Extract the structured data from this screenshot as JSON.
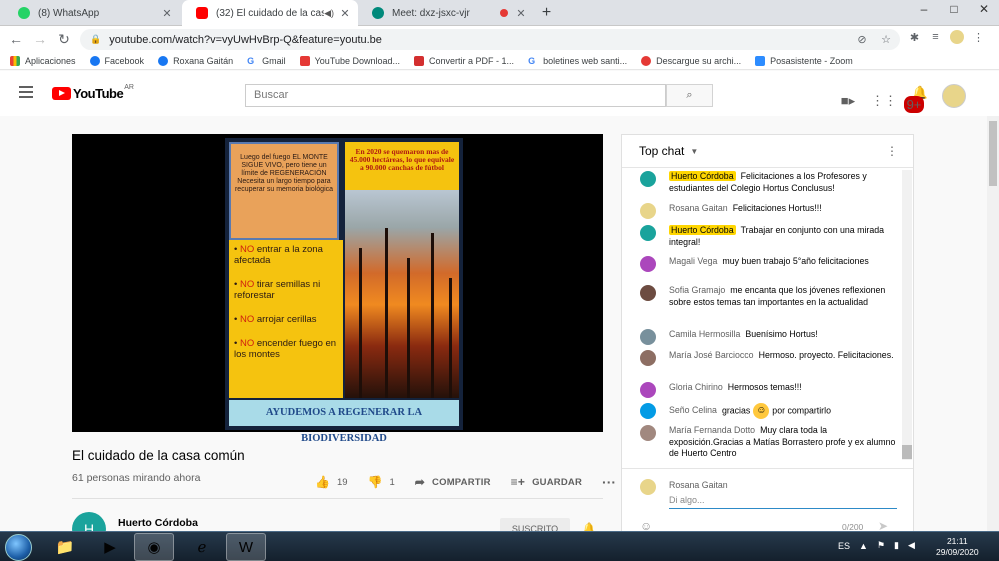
{
  "browser": {
    "tabs": [
      {
        "title": "(8) WhatsApp",
        "fav_color": "#25d366"
      },
      {
        "title": "(32) El cuidado de la casa com",
        "fav_color": "#ff0000"
      },
      {
        "title": "Meet: dxz-jsxc-vjr",
        "fav_color": "#00897b"
      }
    ],
    "new_tab": "+",
    "url": "youtube.com/watch?v=vyUwHvBrp-Q&feature=youtu.be",
    "bookmarks": [
      {
        "label": "Aplicaciones",
        "color": "#e94235"
      },
      {
        "label": "Facebook",
        "color": "#1877f2"
      },
      {
        "label": "Roxana Gaitán",
        "color": "#1877f2"
      },
      {
        "label": "Gmail",
        "color": "#ea4335"
      },
      {
        "label": "YouTube Download...",
        "color": "#e53935"
      },
      {
        "label": "Convertir a PDF - 1...",
        "color": "#d32f2f"
      },
      {
        "label": "boletines web santi...",
        "color": "#4285f4"
      },
      {
        "label": "Descargue su archi...",
        "color": "#e53935"
      },
      {
        "label": "Posasistente - Zoom",
        "color": "#2d8cff"
      }
    ]
  },
  "youtube": {
    "logo": "YouTube",
    "country": "AR",
    "search_placeholder": "Buscar",
    "notif_count": "9+"
  },
  "poster": {
    "left_top": "Luego del fuego EL MONTE SIGUE VIVO, pero tiene un límite de REGENERACIÓN Necesita un largo tiempo para recuperar su memoria biológica",
    "right_top": "En 2020 se quemaron mas de 45.000 hectáreas, lo que equivale a 90.000 canchas de fútbol",
    "rules": [
      {
        "no": "NO",
        "text": " entrar a la zona afectada"
      },
      {
        "no": "NO",
        "text": " tirar semillas ni reforestar"
      },
      {
        "no": "NO",
        "text": " arrojar cerillas"
      },
      {
        "no": "NO",
        "text": " encender fuego en los montes"
      }
    ],
    "banner": "AYUDEMOS A REGENERAR LA BIODIVERSIDAD"
  },
  "video": {
    "title": "El cuidado de la casa común",
    "viewers": "61 personas mirando ahora",
    "likes": "19",
    "dislikes": "1",
    "share": "COMPARTIR",
    "save": "GUARDAR",
    "channel": "Huerto Córdoba",
    "channel_initial": "H",
    "subscribed": "SUSCRITO"
  },
  "chat": {
    "header": "Top chat",
    "messages": [
      {
        "author": "Huerto Córdoba",
        "text": "Felicitaciones a los Profesores y estudiantes del Colegio Hortus Conclusus!",
        "highlight": true,
        "color": "#1aa39c"
      },
      {
        "author": "Rosana Gaitan",
        "text": "Felicitaciones Hortus!!!",
        "highlight": false,
        "color": "#e8d58a"
      },
      {
        "author": "Huerto Córdoba",
        "text": "Trabajar en conjunto con una mirada integral!",
        "highlight": true,
        "color": "#1aa39c"
      },
      {
        "author": "Magali Vega",
        "text": "muy buen trabajo 5°año felicitaciones",
        "highlight": false,
        "color": "#ab47bc"
      },
      {
        "author": "Sofia Gramajo",
        "text": "me encanta que los jóvenes reflexionen sobre estos temas tan importantes en la actualidad",
        "highlight": false,
        "color": "#6d4c41"
      },
      {
        "author": "Camila Hermosilla",
        "text": "Buenísimo Hortus!",
        "highlight": false,
        "color": "#78909c"
      },
      {
        "author": "María José Barciocco",
        "text": "Hermoso. proyecto. Felicitaciones.",
        "highlight": false,
        "color": "#8d6e63"
      },
      {
        "author": "Gloria Chirino",
        "text": "Hermosos temas!!!",
        "highlight": false,
        "color": "#ab47bc"
      },
      {
        "author": "Seño Celina",
        "text": "gracias",
        "text_after": "por compartirlo",
        "highlight": false,
        "color": "#039be5"
      },
      {
        "author": "María Fernanda Dotto",
        "text": "Muy clara toda la exposición.Gracias a Matías Borrastero profe y ex alumno de Huerto Centro",
        "highlight": false,
        "color": "#a1887f"
      }
    ],
    "input_name": "Rosana Gaitan",
    "input_placeholder": "Di algo...",
    "char_count": "0/200"
  },
  "taskbar": {
    "lang": "ES",
    "time": "21:11",
    "date": "29/09/2020"
  }
}
